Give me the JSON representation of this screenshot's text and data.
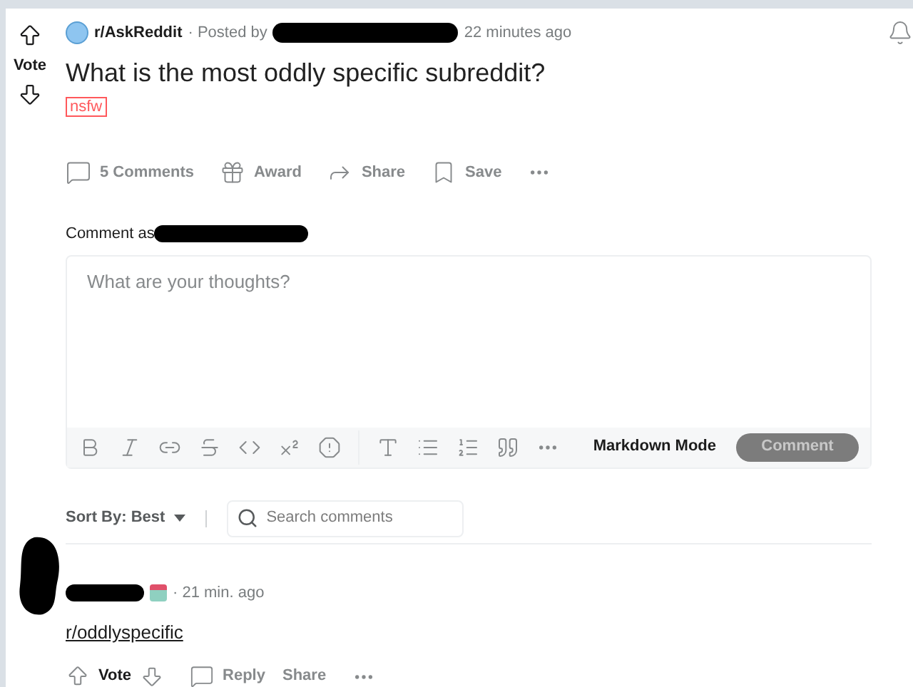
{
  "post": {
    "subreddit": "r/AskReddit",
    "posted_by": "· Posted by",
    "time": "22 minutes ago",
    "vote_label": "Vote",
    "title": "What is the most oddly specific subreddit?",
    "flair": "nsfw",
    "actions": [
      {
        "kind": "comments",
        "label": "5 Comments"
      },
      {
        "kind": "award",
        "label": "Award"
      },
      {
        "kind": "share",
        "label": "Share"
      },
      {
        "kind": "save",
        "label": "Save"
      },
      {
        "kind": "more"
      }
    ]
  },
  "composer": {
    "comment_as": "Comment as",
    "placeholder": "What are your thoughts?",
    "markdown_mode": "Markdown Mode",
    "submit": {
      "label": "Comment",
      "disabled": true
    }
  },
  "sort": {
    "label": "Sort By: Best",
    "search_placeholder": "Search comments"
  },
  "comment": {
    "time": "· 21 min. ago",
    "body": "r/oddlyspecific",
    "vote_label": "Vote",
    "actions": [
      {
        "kind": "reply",
        "label": "Reply"
      },
      {
        "kind": "share",
        "label": "Share"
      },
      {
        "kind": "more"
      }
    ]
  }
}
